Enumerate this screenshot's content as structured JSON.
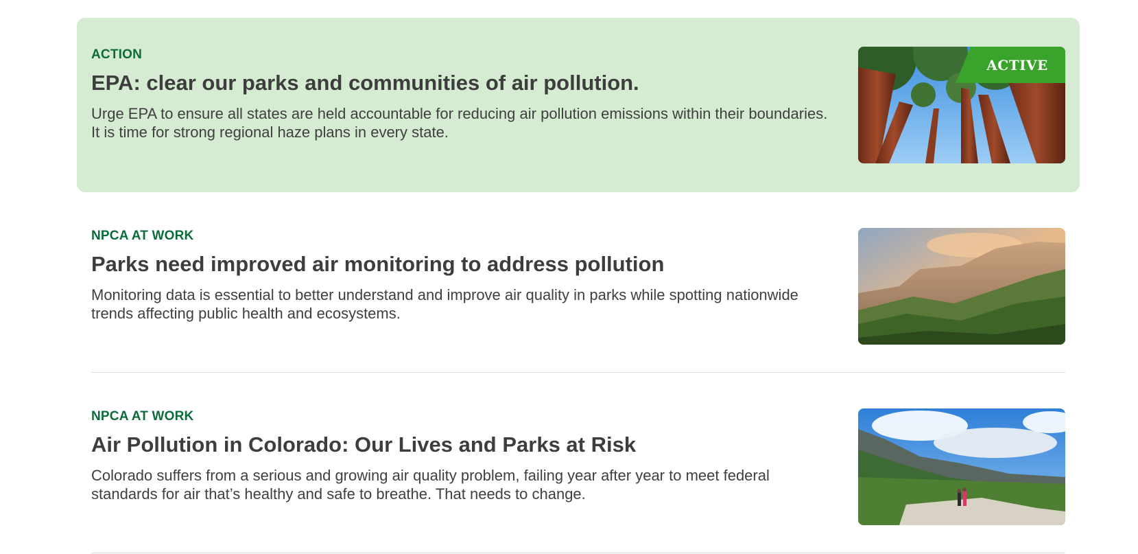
{
  "articles": [
    {
      "category": "ACTION",
      "title": "EPA: clear our parks and communities of air pollution.",
      "description": "Urge EPA to ensure all states are held accountable for reducing air pollution emissions within their boundaries. It is time for strong regional haze plans in every state.",
      "badge": "ACTIVE",
      "image": "sequoia-trees-photo"
    },
    {
      "category": "NPCA AT WORK",
      "title": "Parks need improved air monitoring to address pollution",
      "description": "Monitoring data is essential to better understand and improve air quality in parks while spotting nationwide trends affecting public health and ecosystems.",
      "image": "canyon-cliffs-photo"
    },
    {
      "category": "NPCA AT WORK",
      "title": "Air Pollution in Colorado: Our Lives and Parks at Risk",
      "description": "Colorado suffers from a serious and growing air quality problem, failing year after year to meet federal standards for air that’s healthy and safe to breathe. That needs to change.",
      "image": "mountain-hikers-photo"
    }
  ],
  "colors": {
    "featured_background": "#d6ecd2",
    "category_green": "#0b6b3a",
    "badge_green": "#3aa32c",
    "title_text": "#3d3d3d"
  }
}
